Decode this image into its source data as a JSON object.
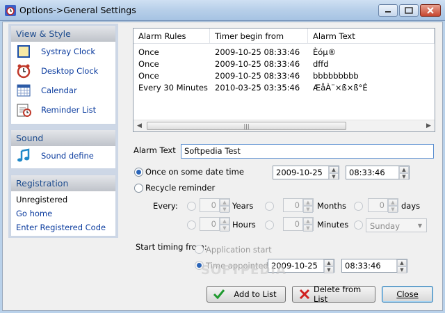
{
  "window": {
    "title": "Options->General Settings"
  },
  "sidebar": {
    "view_style": {
      "header": "View & Style",
      "items": [
        {
          "label": "Systray Clock",
          "icon": "systray-clock-icon"
        },
        {
          "label": "Desktop Clock",
          "icon": "alarm-clock-icon"
        },
        {
          "label": "Calendar",
          "icon": "calendar-icon"
        },
        {
          "label": "Reminder List",
          "icon": "reminder-list-icon"
        }
      ]
    },
    "sound": {
      "header": "Sound",
      "items": [
        {
          "label": "Sound define",
          "icon": "music-note-icon"
        }
      ]
    },
    "registration": {
      "header": "Registration",
      "status": "Unregistered",
      "go_home": "Go home",
      "enter_code": "Enter Registered Code"
    }
  },
  "table": {
    "columns": [
      "Alarm Rules",
      "Timer begin from",
      "Alarm Text"
    ],
    "rows": [
      [
        "Once",
        "2009-10-25 08:33:46",
        "Èóµ®"
      ],
      [
        "Once",
        "2009-10-25 08:33:46",
        "dffd"
      ],
      [
        "Once",
        "2009-10-25 08:33:46",
        "bbbbbbbbb"
      ],
      [
        "Every 30 Minutes",
        "2010-03-25 03:35:46",
        "ÆåÀ¨×ß×ß°É"
      ]
    ]
  },
  "form": {
    "alarm_text_label": "Alarm Text",
    "alarm_text_value": "Softpedia Test",
    "once_label": "Once on some date time",
    "once_date": "2009-10-25",
    "once_time": "08:33:46",
    "recycle_label": "Recycle reminder",
    "every_label": "Every:",
    "years_value": "0",
    "years_label": "Years",
    "months_value": "0",
    "months_label": "Months",
    "days_value": "0",
    "days_label": "days",
    "hours_value": "0",
    "hours_label": "Hours",
    "minutes_value": "0",
    "minutes_label": "Minutes",
    "weekday_value": "Sunday",
    "start_timing_label": "Start timing from:",
    "app_start_label": "Application start",
    "time_appointed_label": "Time appointed",
    "appointed_date": "2009-10-25",
    "appointed_time": "08:33:46"
  },
  "buttons": {
    "add": "Add to List",
    "delete": "Delete from List",
    "close": "Close"
  },
  "watermark": "SOFTPEDIA",
  "colors": {
    "link": "#0a3b9e",
    "header_text": "#1e4c8e",
    "titlebar": "#b9d1ea"
  }
}
